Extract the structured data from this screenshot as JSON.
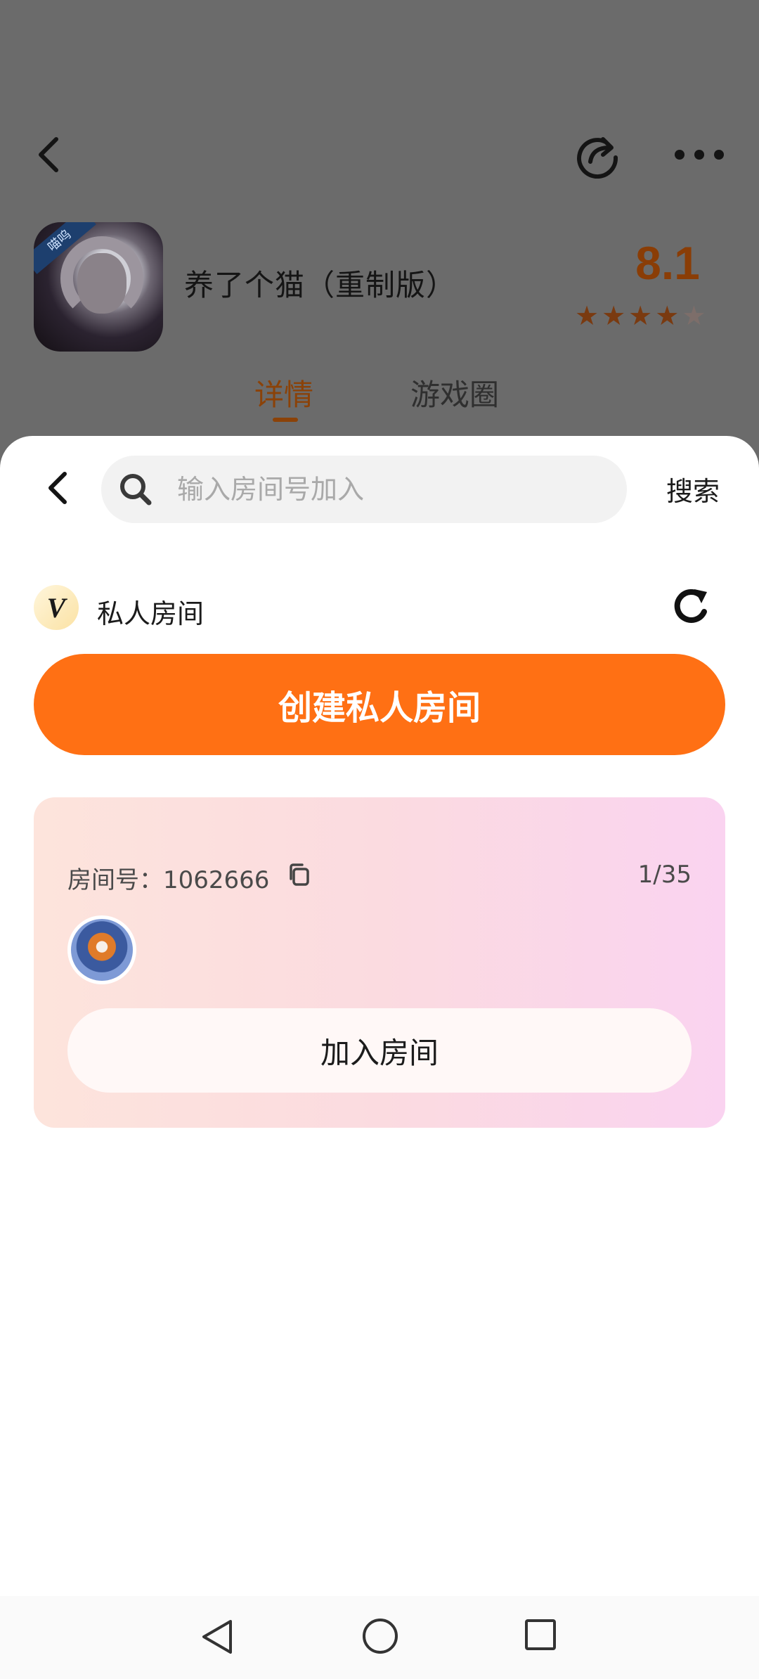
{
  "header": {
    "back_icon": "chevron-left-icon",
    "share_icon": "share-icon",
    "more_icon": "more-horizontal-icon"
  },
  "game": {
    "title": "养了个猫（重制版）",
    "icon_badge_text": "喵呜",
    "score": "8.1",
    "rating_stars": 4.5
  },
  "tabs": [
    {
      "label": "详情",
      "active": true
    },
    {
      "label": "游戏圈",
      "active": false
    }
  ],
  "sheet": {
    "search": {
      "placeholder": "输入房间号加入",
      "button_label": "搜索"
    },
    "section": {
      "badge": "V",
      "title": "私人房间"
    },
    "create_button_label": "创建私人房间",
    "room": {
      "label": "房间号：1062666",
      "count": "1/35",
      "join_button_label": "加入房间"
    }
  },
  "colors": {
    "accent": "#ff7014",
    "overlay": "#6b6b6b"
  },
  "navbar": {
    "back_icon": "triangle-back-icon",
    "home_icon": "circle-home-icon",
    "recent_icon": "square-recent-icon"
  }
}
